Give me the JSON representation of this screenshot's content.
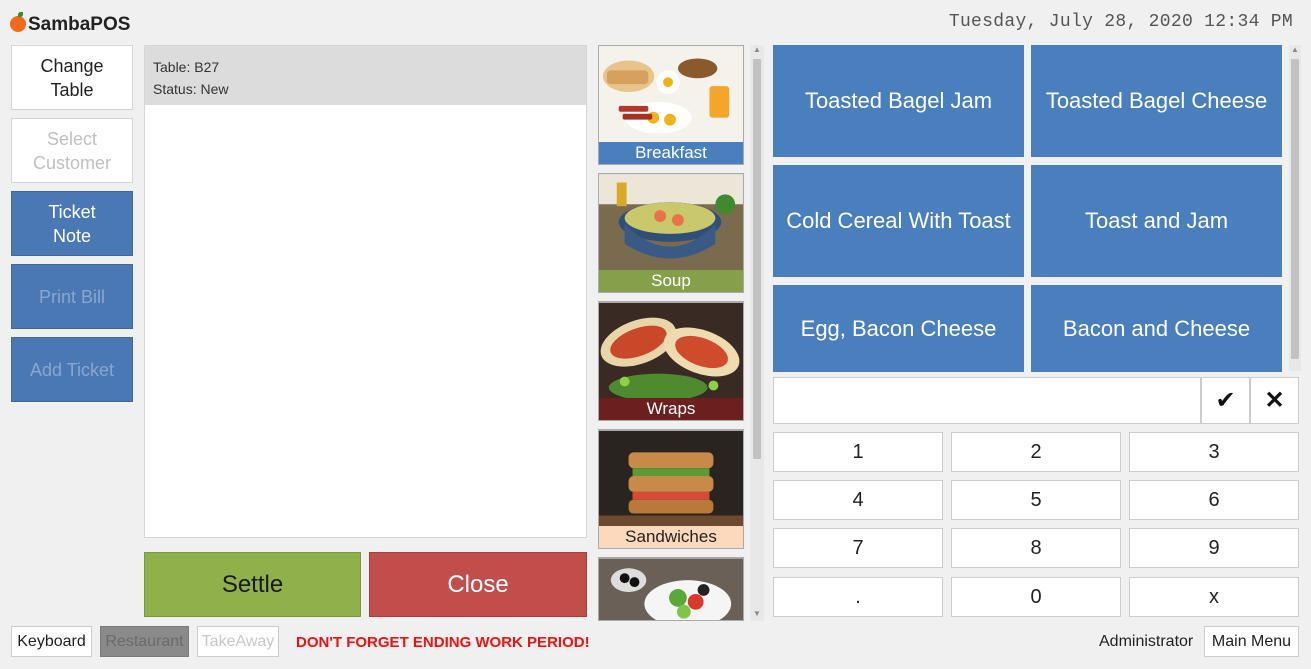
{
  "app": {
    "title": "SambaPOS"
  },
  "header": {
    "datetime": "Tuesday, July 28, 2020 12:34 PM"
  },
  "left_buttons": [
    {
      "label": "Change\nTable",
      "style": "white",
      "enabled": true
    },
    {
      "label": "Select\nCustomer",
      "style": "white",
      "enabled": false
    },
    {
      "label": "Ticket\nNote",
      "style": "blue",
      "enabled": true
    },
    {
      "label": "Print Bill",
      "style": "blue",
      "enabled": false
    },
    {
      "label": "Add Ticket",
      "style": "blue",
      "enabled": false
    }
  ],
  "ticket": {
    "table": "Table: B27",
    "status": "Status: New"
  },
  "actions": {
    "settle": "Settle",
    "close": "Close"
  },
  "categories": [
    {
      "label": "Breakfast",
      "color": "#4a7fbd",
      "text_color": "#ffffff"
    },
    {
      "label": "Soup",
      "color": "#86a04a",
      "text_color": "#ffffff"
    },
    {
      "label": "Wraps",
      "color": "#6b1f1f",
      "text_color": "#ffffff"
    },
    {
      "label": "Sandwiches",
      "color": "#fcd8bd",
      "text_color": "#222222"
    },
    {
      "label": "",
      "color": "#555555",
      "text_color": "#ffffff"
    }
  ],
  "products": [
    "Toasted Bagel Jam",
    "Toasted Bagel Cheese",
    "Cold Cereal With Toast",
    "Toast and Jam",
    "Egg, Bacon Cheese",
    "Bacon and Cheese"
  ],
  "numpad": {
    "input_value": "",
    "ok_icon": "check-icon",
    "cancel_icon": "x-icon",
    "keys": [
      "1",
      "2",
      "3",
      "4",
      "5",
      "6",
      "7",
      "8",
      "9",
      ".",
      "0",
      "x"
    ]
  },
  "footer": {
    "keyboard": "Keyboard",
    "restaurant": "Restaurant",
    "takeaway": "TakeAway",
    "warning": "DON'T FORGET ENDING WORK PERIOD!",
    "user": "Administrator",
    "main_menu": "Main Menu"
  }
}
